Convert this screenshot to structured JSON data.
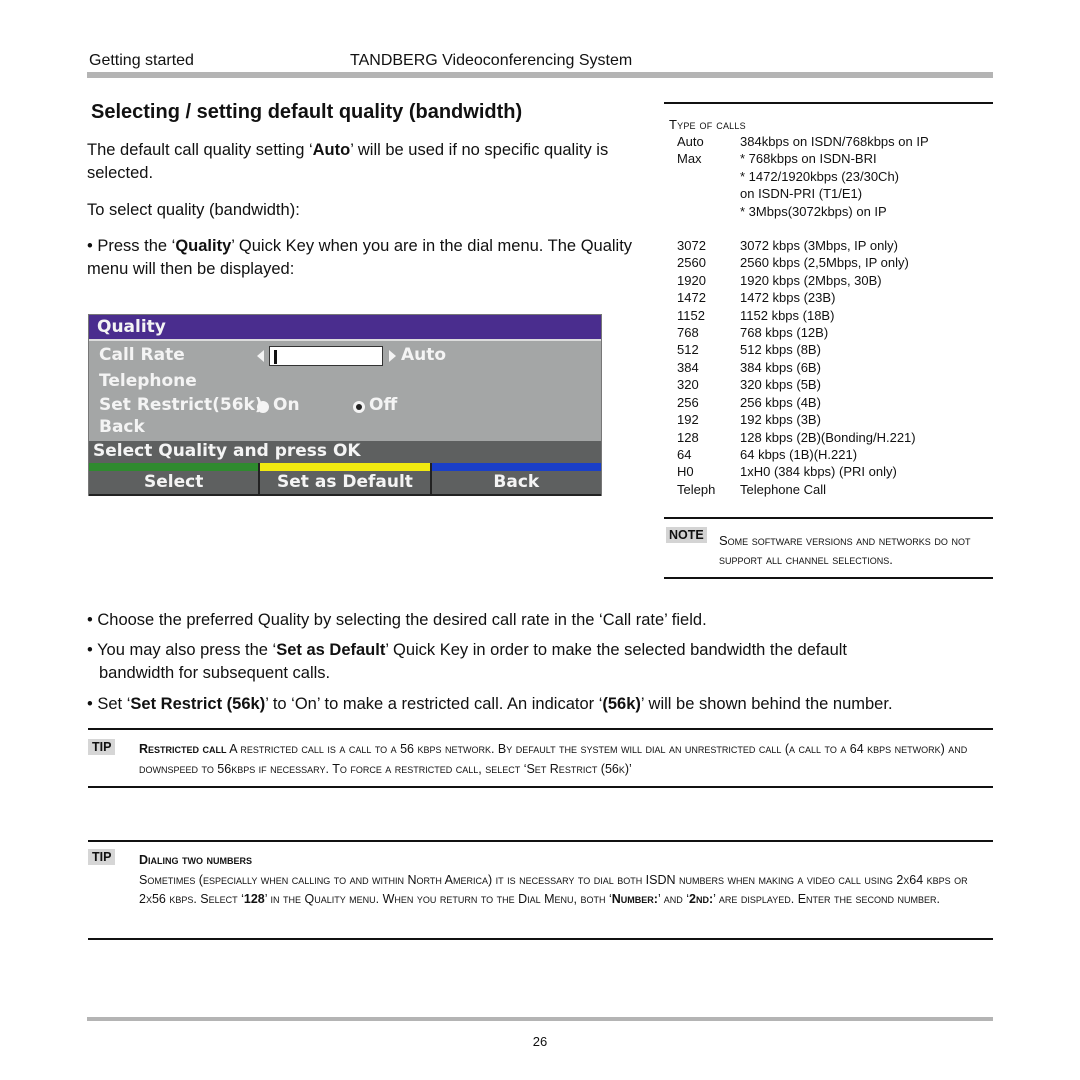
{
  "header": {
    "section": "Getting started",
    "product": "TANDBERG Videoconferencing System"
  },
  "title": "Selecting / setting default quality (bandwidth)",
  "intro": {
    "p1_pre": "The default call quality setting ‘",
    "p1_bold": "Auto",
    "p1_post": "’ will be used if no specific quality is selected.",
    "p2": "To select quality (bandwidth):",
    "p3_pre": "• Press the ‘",
    "p3_bold": "Quality",
    "p3_post": "’ Quick Key when you are in the dial menu. The Quality menu will then be displayed:"
  },
  "quality_menu": {
    "title": "Quality",
    "call_rate_label": "Call Rate",
    "call_rate_input_value": "",
    "call_rate_value": "Auto",
    "telephone_label": "Telephone",
    "restrict_label": "Set Restrict(56k)",
    "restrict_on_label": "On",
    "restrict_off_label": "Off",
    "restrict_selected": "Off",
    "back_label": "Back",
    "status": "Select Quality and press OK",
    "softkeys": [
      {
        "label": "Select",
        "color": "#2f8a2f"
      },
      {
        "label": "Set as Default",
        "color": "#f2ea10"
      },
      {
        "label": "Back",
        "color": "#1a3fc8"
      }
    ],
    "colors": {
      "title_bg": "#4a2d8e",
      "body_bg": "#a4a6a6",
      "status_bg": "#5e6060"
    }
  },
  "sidebar": {
    "heading": "Type of calls",
    "type_rows": [
      {
        "key": "Auto",
        "value": "384kbps on ISDN/768kbps on IP"
      },
      {
        "key": "Max",
        "value": "* 768kbps on ISDN-BRI"
      },
      {
        "key": "",
        "value": "* 1472/1920kbps (23/30Ch)"
      },
      {
        "key": "",
        "value": "  on ISDN-PRI (T1/E1)"
      },
      {
        "key": "",
        "value": "* 3Mbps(3072kbps) on IP"
      }
    ],
    "rate_rows": [
      {
        "key": "3072",
        "value": "3072 kbps (3Mbps, IP only)"
      },
      {
        "key": "2560",
        "value": "2560 kbps (2,5Mbps, IP only)"
      },
      {
        "key": "1920",
        "value": "1920 kbps (2Mbps, 30B)"
      },
      {
        "key": "1472",
        "value": "1472 kbps (23B)"
      },
      {
        "key": "1152",
        "value": "1152 kbps (18B)"
      },
      {
        "key": "768",
        "value": "768 kbps (12B)"
      },
      {
        "key": "512",
        "value": "512 kbps (8B)"
      },
      {
        "key": "384",
        "value": "384 kbps (6B)"
      },
      {
        "key": "320",
        "value": "320 kbps (5B)"
      },
      {
        "key": "256",
        "value": "256 kbps (4B)"
      },
      {
        "key": "192",
        "value": "192 kbps (3B)"
      },
      {
        "key": "128",
        "value": "128 kbps (2B)(Bonding/H.221)"
      },
      {
        "key": "64",
        "value": "64 kbps (1B)(H.221)"
      },
      {
        "key": "H0",
        "value": "1xH0 (384 kbps) (PRI only)"
      },
      {
        "key": "Teleph",
        "value": "Telephone Call"
      }
    ],
    "note_badge": "NOTE",
    "note_text": "Some software versions and networks do not support all channel selections."
  },
  "bullets": {
    "b1": "• Choose the preferred Quality by selecting the desired call rate in the ‘Call rate’ field.",
    "b2_pre": "• You may also press the ‘",
    "b2_bold": "Set as Default",
    "b2_post": "’ Quick Key in order to make the selected bandwidth the default",
    "b2_cont": "bandwidth for subsequent calls.",
    "b3_pre": "• Set ‘",
    "b3_bold": "Set Restrict (56k)",
    "b3_mid": "’ to ‘On’ to make a restricted call. An indicator ‘",
    "b3_bold2": "(56k)",
    "b3_post": "’ will be shown behind the number."
  },
  "tips": [
    {
      "badge": "TIP",
      "title": "Restricted call",
      "text": "A restricted call is a call to a 56 kbps network. By default the system will dial an unrestricted call (a call to a 64 kbps network) and downspeed to 56kbps if necessary. To force a restricted call, select ‘Set Restrict (56k)’"
    },
    {
      "badge": "TIP",
      "title": "Dialing two numbers",
      "text_pre": "Sometimes (especially when calling to and within North America) it is necessary to dial both ISDN numbers when making a video call using 2x64 kbps or 2x56 kbps. Select ‘",
      "bold1": "128",
      "text_mid": "’ in the Quality menu. When you return to the Dial Menu, both ‘",
      "bold2": "Number:",
      "text_mid2": "’ and ‘",
      "bold3": "2nd:",
      "text_post": "’ are displayed. Enter the second number."
    }
  ],
  "footer": {
    "page_number": "26"
  }
}
